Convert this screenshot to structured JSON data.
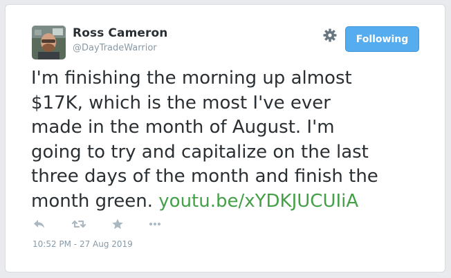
{
  "user": {
    "name": "Ross Cameron",
    "handle": "@DayTradeWarrior",
    "avatar_icon": "user-avatar-photo"
  },
  "header": {
    "settings_icon": "gear-icon",
    "follow_label": "Following"
  },
  "tweet": {
    "text": "I'm finishing the morning up almost $17K, which is the most I've ever made in the month of August. I'm going to try and capitalize on the last three days of the month and finish the month green.",
    "lines": [
      "I'm finishing the morning up almost",
      "$17K, which is the most I've ever",
      "made in the month of August. I'm",
      "going to try and capitalize on the last",
      "three days of the month and finish the",
      "month green."
    ],
    "link": "youtu.be/xYDKJUCUIiA"
  },
  "actions": [
    {
      "name": "reply",
      "icon": "reply-icon"
    },
    {
      "name": "retweet",
      "icon": "retweet-icon"
    },
    {
      "name": "like",
      "icon": "star-icon"
    },
    {
      "name": "more",
      "icon": "more-icon"
    }
  ],
  "timestamp": "10:52 PM - 27 Aug 2019",
  "colors": {
    "accent": "#55acee",
    "link": "#43a047",
    "text": "#292f33",
    "muted": "#8899a6",
    "icon": "#aab8c2"
  }
}
